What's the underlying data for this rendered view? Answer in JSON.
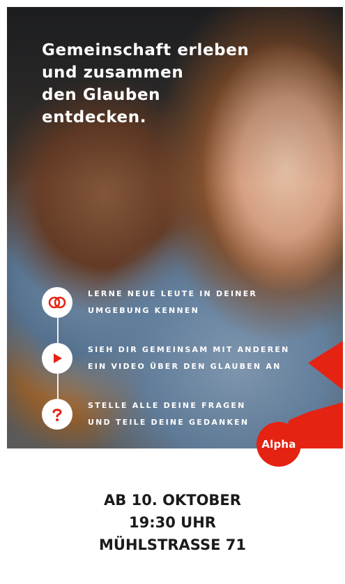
{
  "headline": {
    "lines": [
      "Gemeinschaft erleben",
      "und zusammen",
      "den Glauben",
      "entdecken."
    ]
  },
  "features": [
    {
      "icon": "rings-icon",
      "lines": [
        "LERNE NEUE LEUTE IN DEINER",
        "UMGEBUNG KENNEN"
      ]
    },
    {
      "icon": "play-icon",
      "lines": [
        "SIEH DIR GEMEINSAM MIT ANDEREN",
        "EIN VIDEO ÜBER DEN GLAUBEN AN"
      ]
    },
    {
      "icon": "question-icon",
      "lines": [
        "STELLE ALLE DEINE FRAGEN",
        "UND TEILE DEINE GEDANKEN"
      ]
    }
  ],
  "logo": {
    "text": "Alpha"
  },
  "event": {
    "date": "AB 10. OKTOBER",
    "time": "19:30 UHR",
    "address": "MÜHLSTRASSE 71"
  },
  "colors": {
    "accent": "#e42313",
    "text_dark": "#1a1a1a",
    "text_light": "#ffffff"
  }
}
